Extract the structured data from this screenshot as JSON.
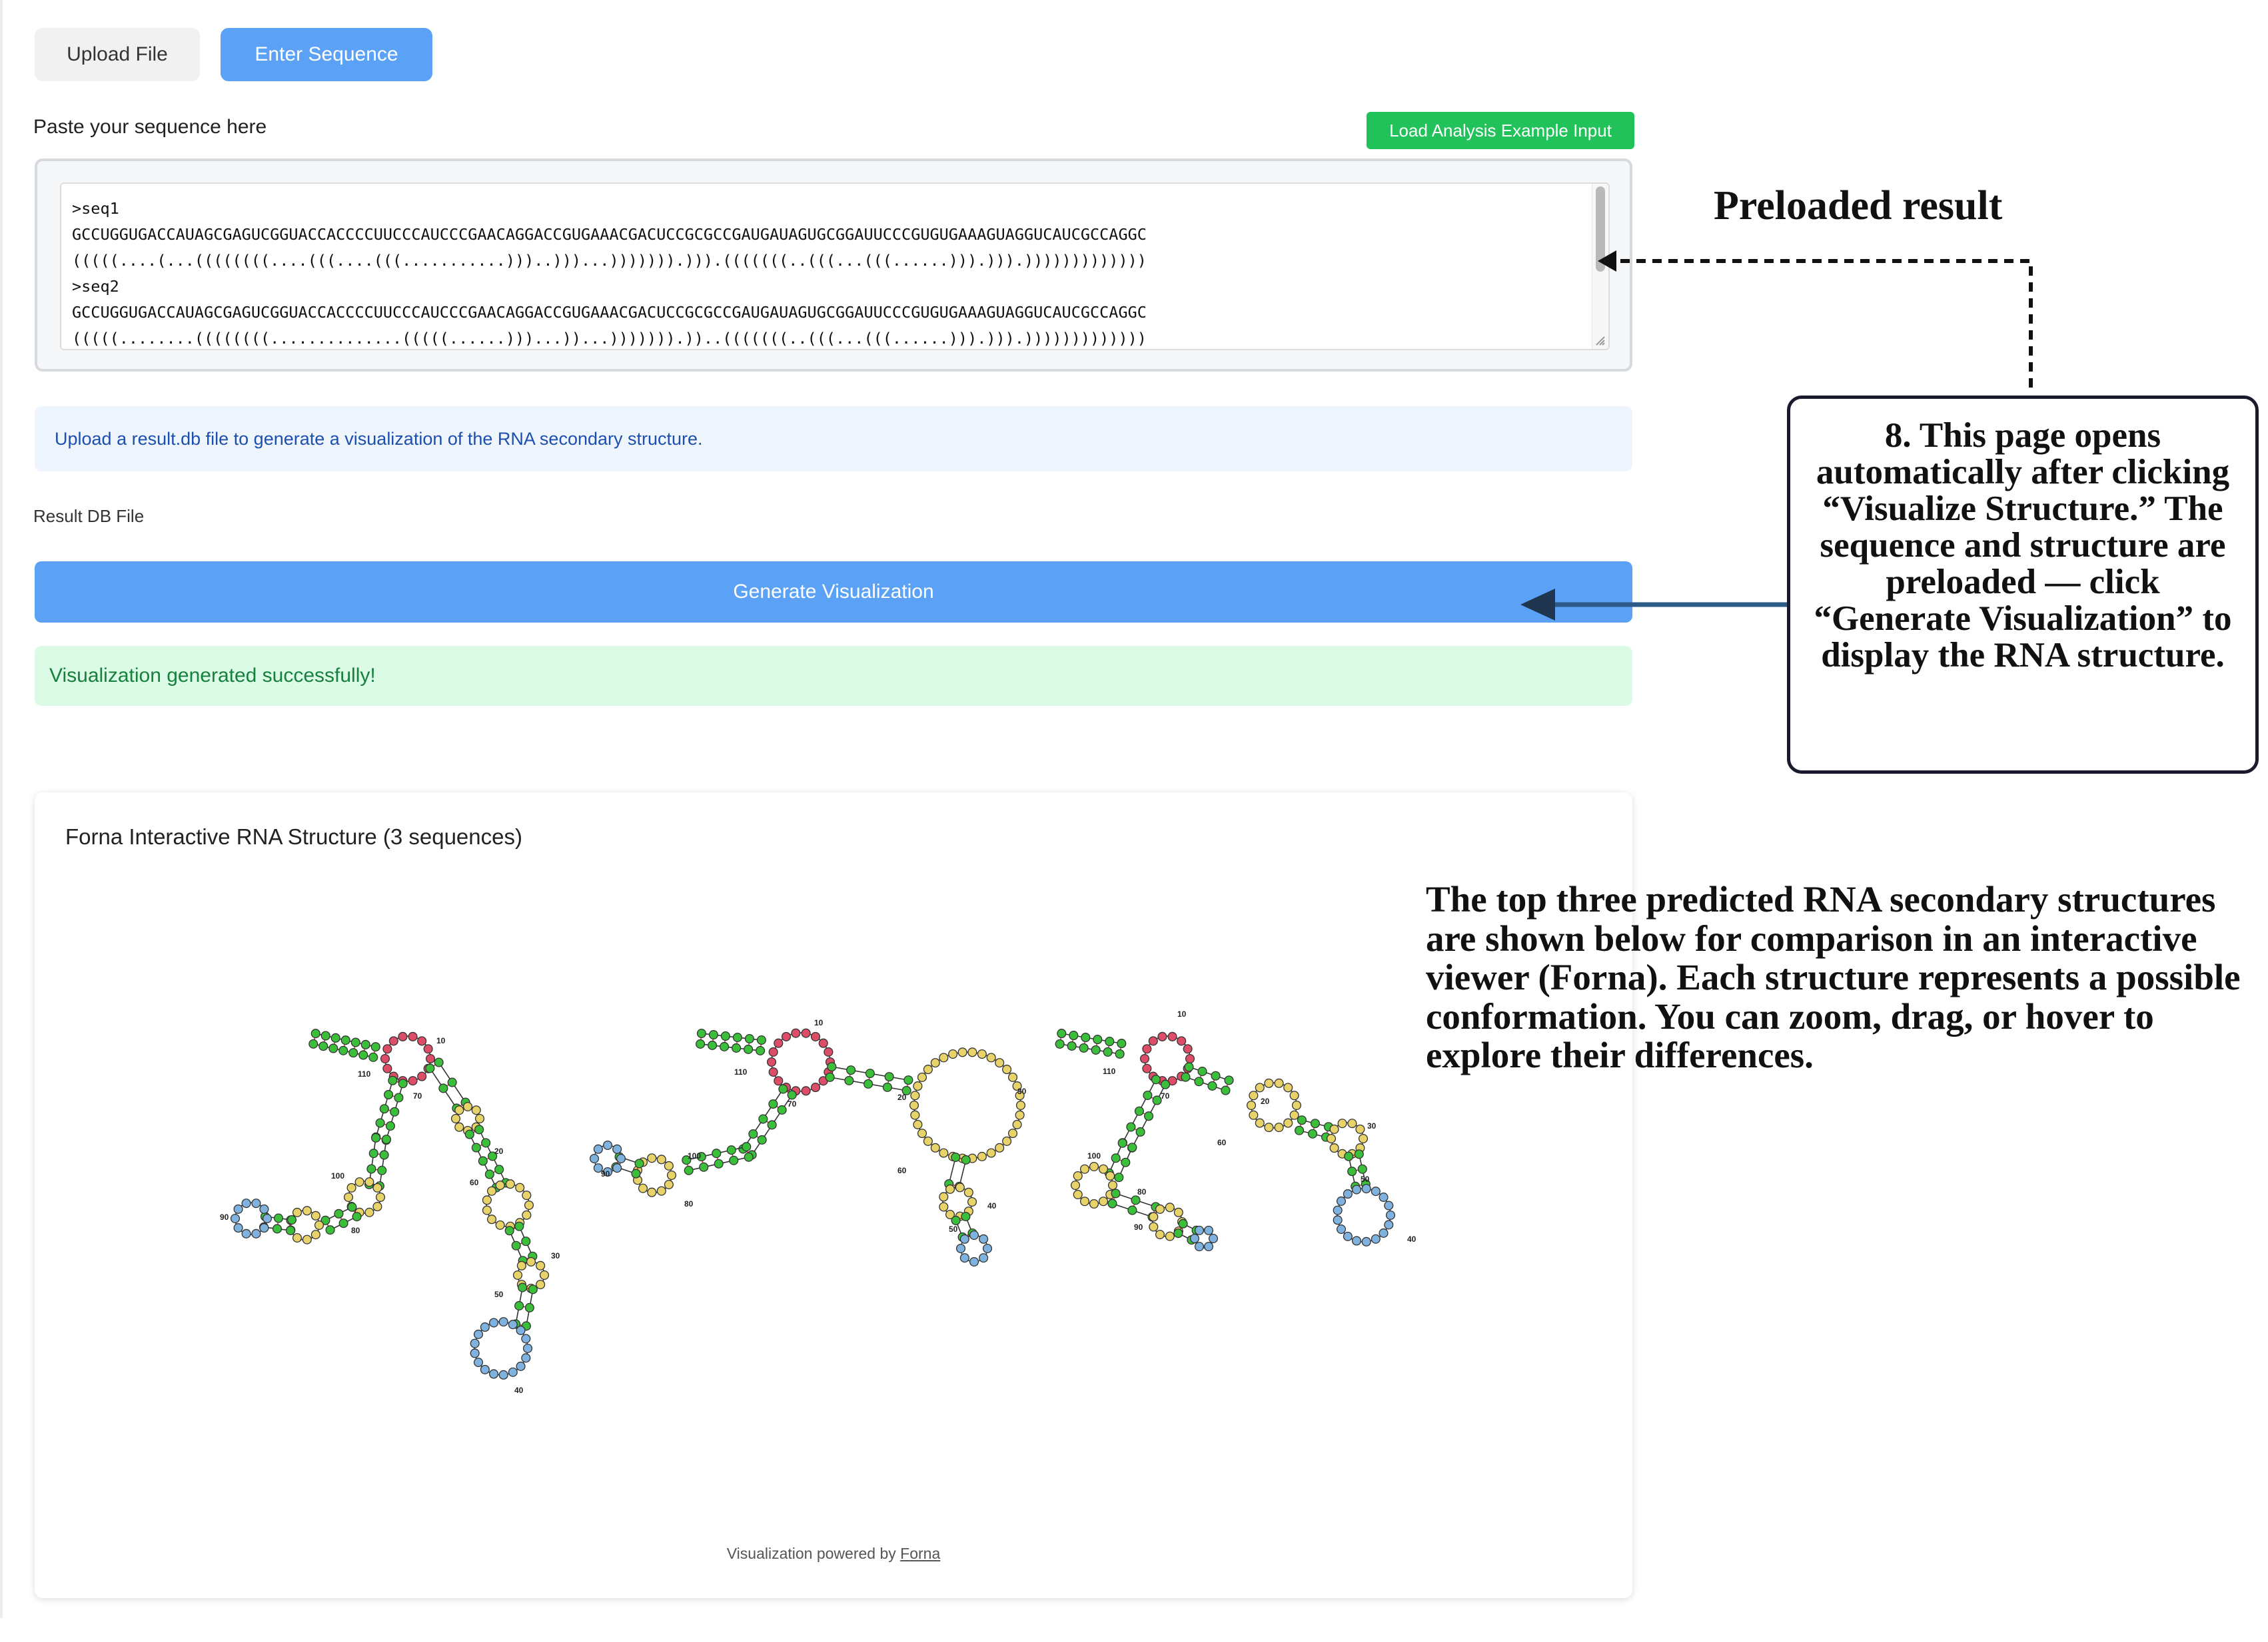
{
  "tabs": {
    "upload_label": "Upload File",
    "enter_label": "Enter Sequence"
  },
  "input": {
    "paste_label": "Paste your sequence here",
    "example_button": "Load Analysis Example Input",
    "sequence_lines": [
      ">seq1",
      "GCCUGGUGACCAUAGCGAGUCGGUACCACCCCUUCCCAUCCCGAACAGGACCGUGAAACGACUCCGCGCCGAUGAUAGUGCGGAUUCCCGUGUGAAAGUAGGUCAUCGCCAGGC",
      "(((((....(...((((((((....(((....(((...........)))..)))...))))))).))).(((((((..(((...(((......))).))).)))))))))))))",
      ">seq2",
      "GCCUGGUGACCAUAGCGAGUCGGUACCACCCCUUCCCAUCCCGAACAGGACCGUGAAACGACUCCGCGCCGAUGAUAGUGCGGAUUCCCGUGUGAAAGUAGGUCAUCGCCAGGC",
      "(((((........((((((((..............(((((......)))...))...))))))).))..(((((((..(((...(((......))).))).)))))))))))))"
    ]
  },
  "info_message": "Upload a result.db file to generate a visualization of the RNA secondary structure.",
  "db_label": "Result DB File",
  "generate_button": "Generate Visualization",
  "success_message": "Visualization generated successfully!",
  "viz": {
    "title": "Forna Interactive RNA Structure (3 sequences)",
    "footer_prefix": "Visualization powered by ",
    "footer_link": "Forna",
    "colors": {
      "stem": "#3bbf3b",
      "hairpin": "#7fb2df",
      "interior": "#e8d36a",
      "multiloop": "#dc4e67",
      "link": "#333333"
    },
    "structures": [
      {
        "labels": [
          "10",
          "110",
          "70",
          "20",
          "100",
          "60",
          "80",
          "90",
          "30",
          "50",
          "40"
        ]
      },
      {
        "labels": [
          "10",
          "110",
          "70",
          "20",
          "100",
          "30",
          "60",
          "80",
          "90",
          "40",
          "50"
        ]
      },
      {
        "labels": [
          "10",
          "110",
          "70",
          "20",
          "30",
          "100",
          "60",
          "80",
          "90",
          "50",
          "40"
        ]
      }
    ]
  },
  "annotations": {
    "preloaded_title": "Preloaded result",
    "step_note": "8. This page opens automatically after clicking “Visualize Structure.” The sequence and structure are preloaded — click “Generate Visualization” to display the RNA structure.",
    "description": "The top three predicted RNA secondary structures are shown below for comparison in an interactive viewer (Forna). Each structure represents a possible conformation. You can zoom, drag, or hover to explore their differences."
  }
}
